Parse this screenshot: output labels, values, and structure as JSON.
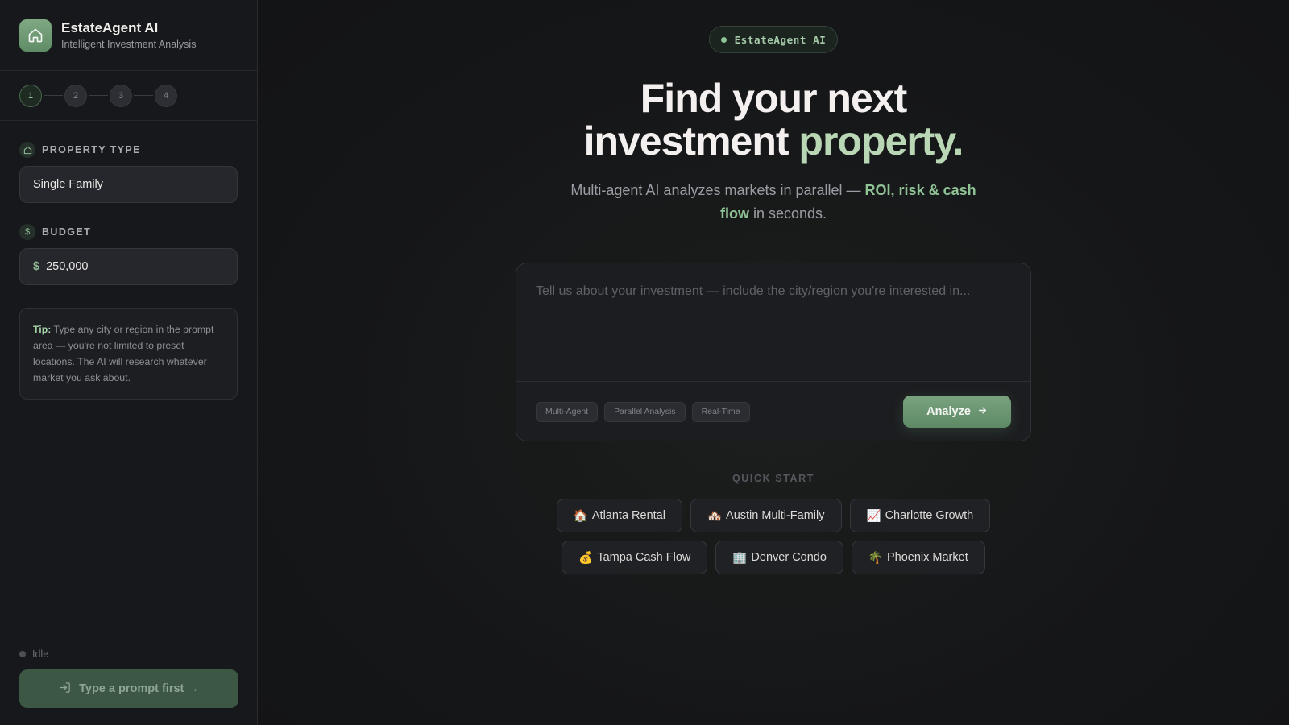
{
  "brand": {
    "title": "EstateAgent AI",
    "subtitle": "Intelligent Investment Analysis"
  },
  "steps": [
    "1",
    "2",
    "3",
    "4"
  ],
  "property_type": {
    "label": "PROPERTY TYPE",
    "value": "Single Family"
  },
  "budget": {
    "label": "BUDGET",
    "currency": "$",
    "value": "250,000"
  },
  "tip": {
    "key": "Tip:",
    "text": " Type any city or region in the prompt area — you're not limited to preset locations. The AI will research whatever market you ask about."
  },
  "status": {
    "text": "Idle"
  },
  "footer_button": {
    "label": "Type a prompt first →"
  },
  "pill": {
    "label": "EstateAgent AI"
  },
  "hero": {
    "line1": "Find your next",
    "line2_a": "investment ",
    "line2_b": "property.",
    "sub_a": "Multi-agent AI analyzes markets in parallel — ",
    "sub_hl": "ROI, risk & cash flow",
    "sub_b": " in seconds."
  },
  "prompt": {
    "placeholder": "Tell us about your investment — include the city/region you're interested in...",
    "chips": [
      "Multi-Agent",
      "Parallel Analysis",
      "Real-Time"
    ],
    "analyze_label": "Analyze"
  },
  "quick_start": {
    "label": "QUICK START",
    "row1": [
      {
        "emoji": "🏠",
        "label": "Atlanta Rental"
      },
      {
        "emoji": "🏘️",
        "label": "Austin Multi-Family"
      },
      {
        "emoji": "📈",
        "label": "Charlotte Growth"
      }
    ],
    "row2": [
      {
        "emoji": "💰",
        "label": "Tampa Cash Flow"
      },
      {
        "emoji": "🏢",
        "label": "Denver Condo"
      },
      {
        "emoji": "🌴",
        "label": "Phoenix Market"
      }
    ]
  },
  "colors": {
    "accent": "#7aa27f",
    "background": "#141517",
    "sidebar": "#17181b"
  }
}
